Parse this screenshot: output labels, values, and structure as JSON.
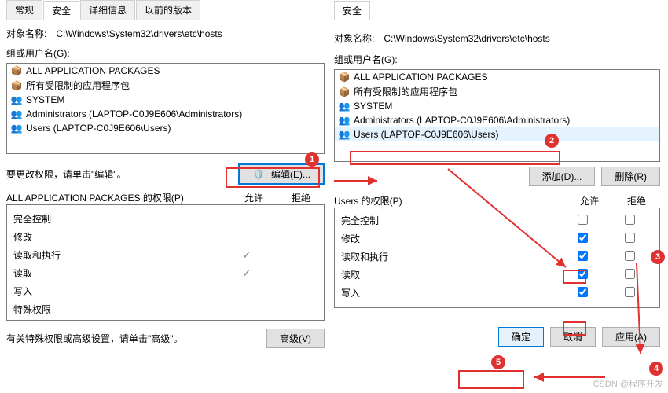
{
  "left": {
    "tabs": [
      "常规",
      "安全",
      "详细信息",
      "以前的版本"
    ],
    "active_tab": 1,
    "object_name_label": "对象名称:",
    "object_path": "C:\\Windows\\System32\\drivers\\etc\\hosts",
    "groups_label": "组或用户名(G):",
    "groups": [
      "ALL APPLICATION PACKAGES",
      "所有受限制的应用程序包",
      "SYSTEM",
      "Administrators (LAPTOP-C0J9E606\\Administrators)",
      "Users (LAPTOP-C0J9E606\\Users)"
    ],
    "edit_hint": "要更改权限，请单击\"编辑\"。",
    "edit_btn": "编辑(E)...",
    "perm_title": "ALL APPLICATION PACKAGES 的权限(P)",
    "perm_allow": "允许",
    "perm_deny": "拒绝",
    "perms": [
      {
        "name": "完全控制",
        "allow": false,
        "deny": false
      },
      {
        "name": "修改",
        "allow": false,
        "deny": false
      },
      {
        "name": "读取和执行",
        "allow": true,
        "deny": false
      },
      {
        "name": "读取",
        "allow": true,
        "deny": false
      },
      {
        "name": "写入",
        "allow": false,
        "deny": false
      },
      {
        "name": "特殊权限",
        "allow": false,
        "deny": false
      }
    ],
    "adv_hint": "有关特殊权限或高级设置，请单击\"高级\"。",
    "adv_btn": "高级(V)"
  },
  "right": {
    "tab": "安全",
    "object_name_label": "对象名称:",
    "object_path": "C:\\Windows\\System32\\drivers\\etc\\hosts",
    "groups_label": "组或用户名(G):",
    "groups": [
      "ALL APPLICATION PACKAGES",
      "所有受限制的应用程序包",
      "SYSTEM",
      "Administrators (LAPTOP-C0J9E606\\Administrators)",
      "Users (LAPTOP-C0J9E606\\Users)"
    ],
    "selected_group": 4,
    "add_btn": "添加(D)...",
    "remove_btn": "删除(R)",
    "perm_title": "Users 的权限(P)",
    "perm_allow": "允许",
    "perm_deny": "拒绝",
    "perms": [
      {
        "name": "完全控制",
        "allow": false,
        "deny": false
      },
      {
        "name": "修改",
        "allow": true,
        "deny": false
      },
      {
        "name": "读取和执行",
        "allow": true,
        "deny": false
      },
      {
        "name": "读取",
        "allow": true,
        "deny": false
      },
      {
        "name": "写入",
        "allow": true,
        "deny": false
      }
    ],
    "ok_btn": "确定",
    "cancel_btn": "取消",
    "apply_btn": "应用(A)"
  },
  "markers": {
    "m1": "1",
    "m2": "2",
    "m3": "3",
    "m4": "4",
    "m5": "5"
  },
  "watermark": "CSDN @程序开发"
}
